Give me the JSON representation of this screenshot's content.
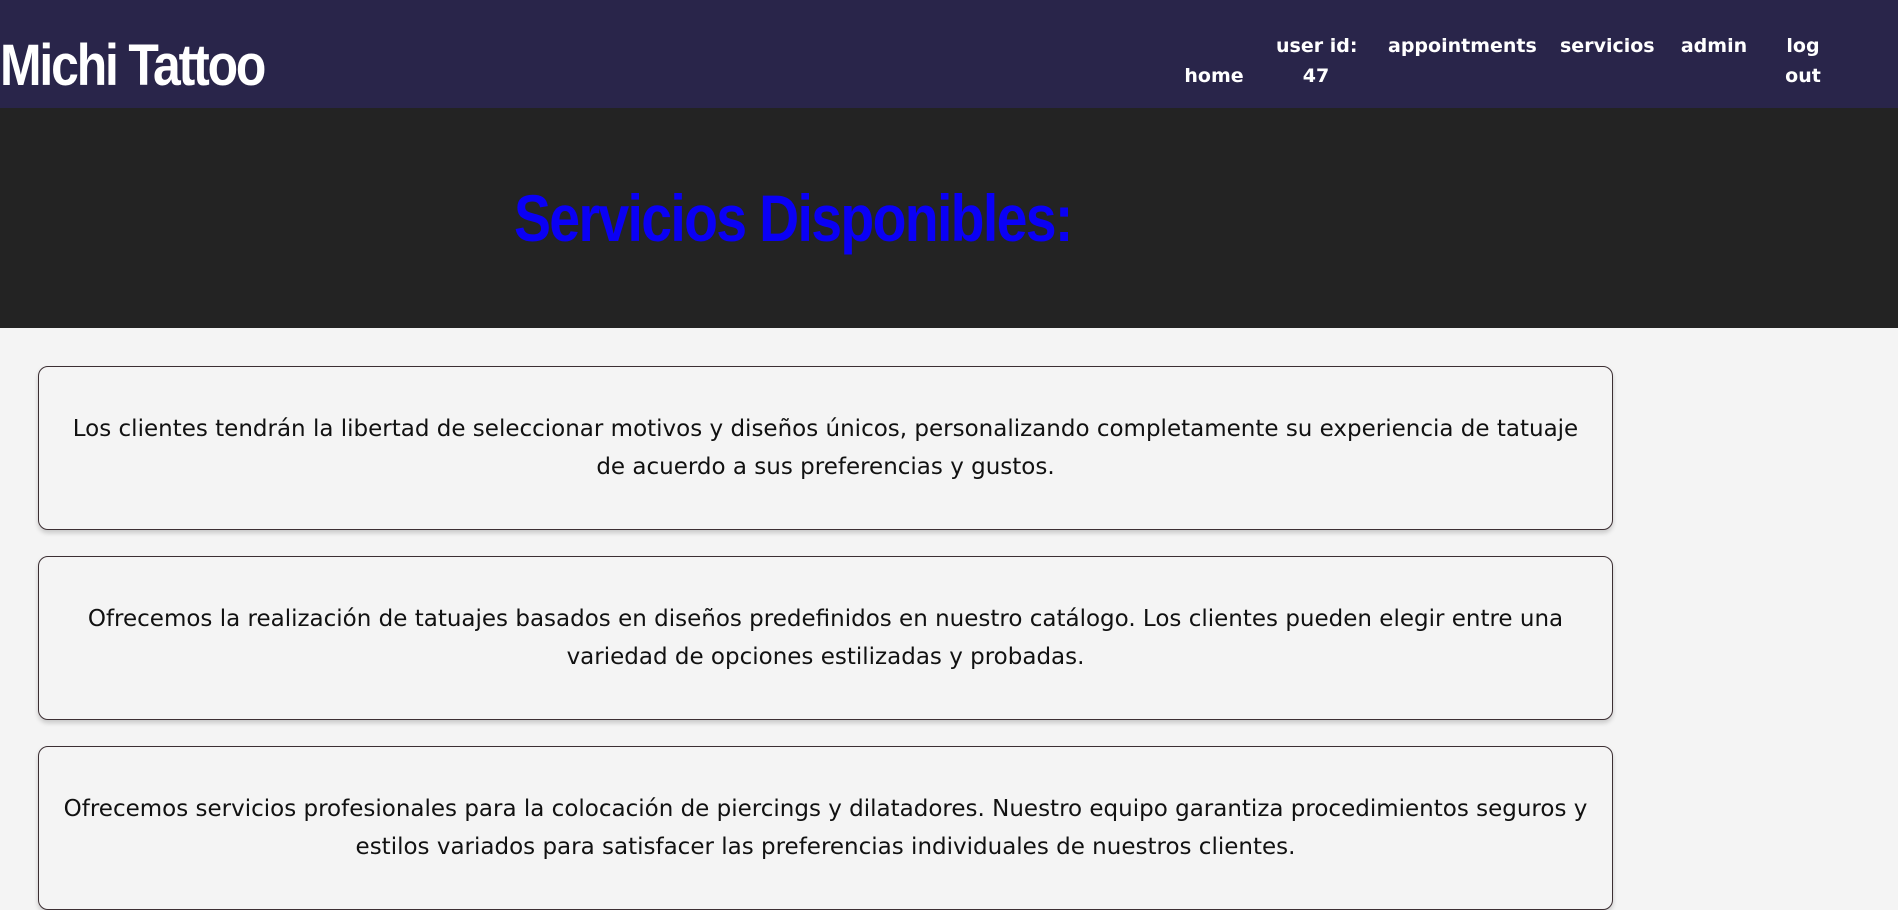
{
  "header": {
    "brand": "Michi Tattoo",
    "nav": {
      "home": "home",
      "user_id_label": "user id:",
      "user_id_value": "47",
      "appointments": "appointments",
      "servicios": "servicios",
      "admin": "admin",
      "logout_line1": "log",
      "logout_line2": "out"
    }
  },
  "hero": {
    "title": "Servicios Disponibles:"
  },
  "services": [
    {
      "description": "Los clientes tendrán la libertad de seleccionar motivos y diseños únicos, personalizando completamente su experiencia de tatuaje de acuerdo a sus preferencias y gustos."
    },
    {
      "description": "Ofrecemos la realización de tatuajes basados en diseños predefinidos en nuestro catálogo. Los clientes pueden elegir entre una variedad de opciones estilizadas y probadas."
    },
    {
      "description": "Ofrecemos servicios profesionales para la colocación de piercings y dilatadores. Nuestro equipo garantiza procedimientos seguros y estilos variados para satisfacer las preferencias individuales de nuestros clientes."
    }
  ]
}
